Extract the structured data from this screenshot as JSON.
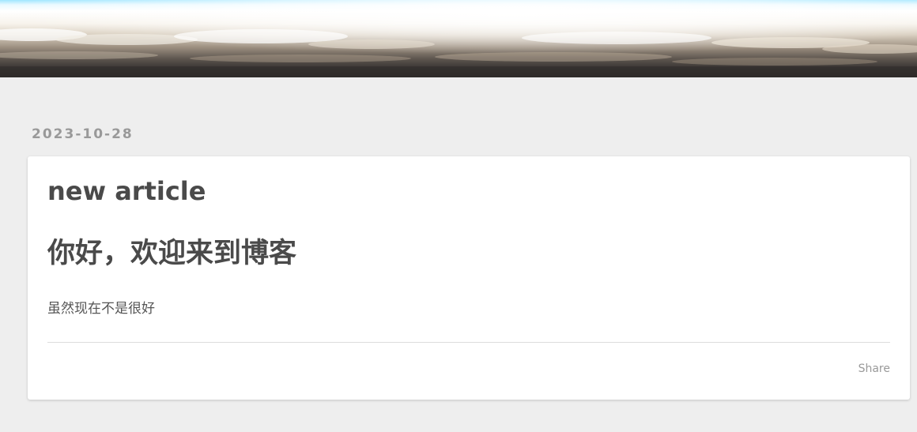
{
  "banner": {
    "image": "sky-clouds-banner"
  },
  "post": {
    "date": "2023-10-28",
    "title": "new article",
    "heading": "你好，欢迎来到博客",
    "paragraph": "虽然现在不是很好",
    "share_label": "Share"
  },
  "colors": {
    "page_background": "#eeeeee",
    "card_background": "#ffffff",
    "title_text": "#4a4a4a",
    "muted_text": "#999999"
  }
}
